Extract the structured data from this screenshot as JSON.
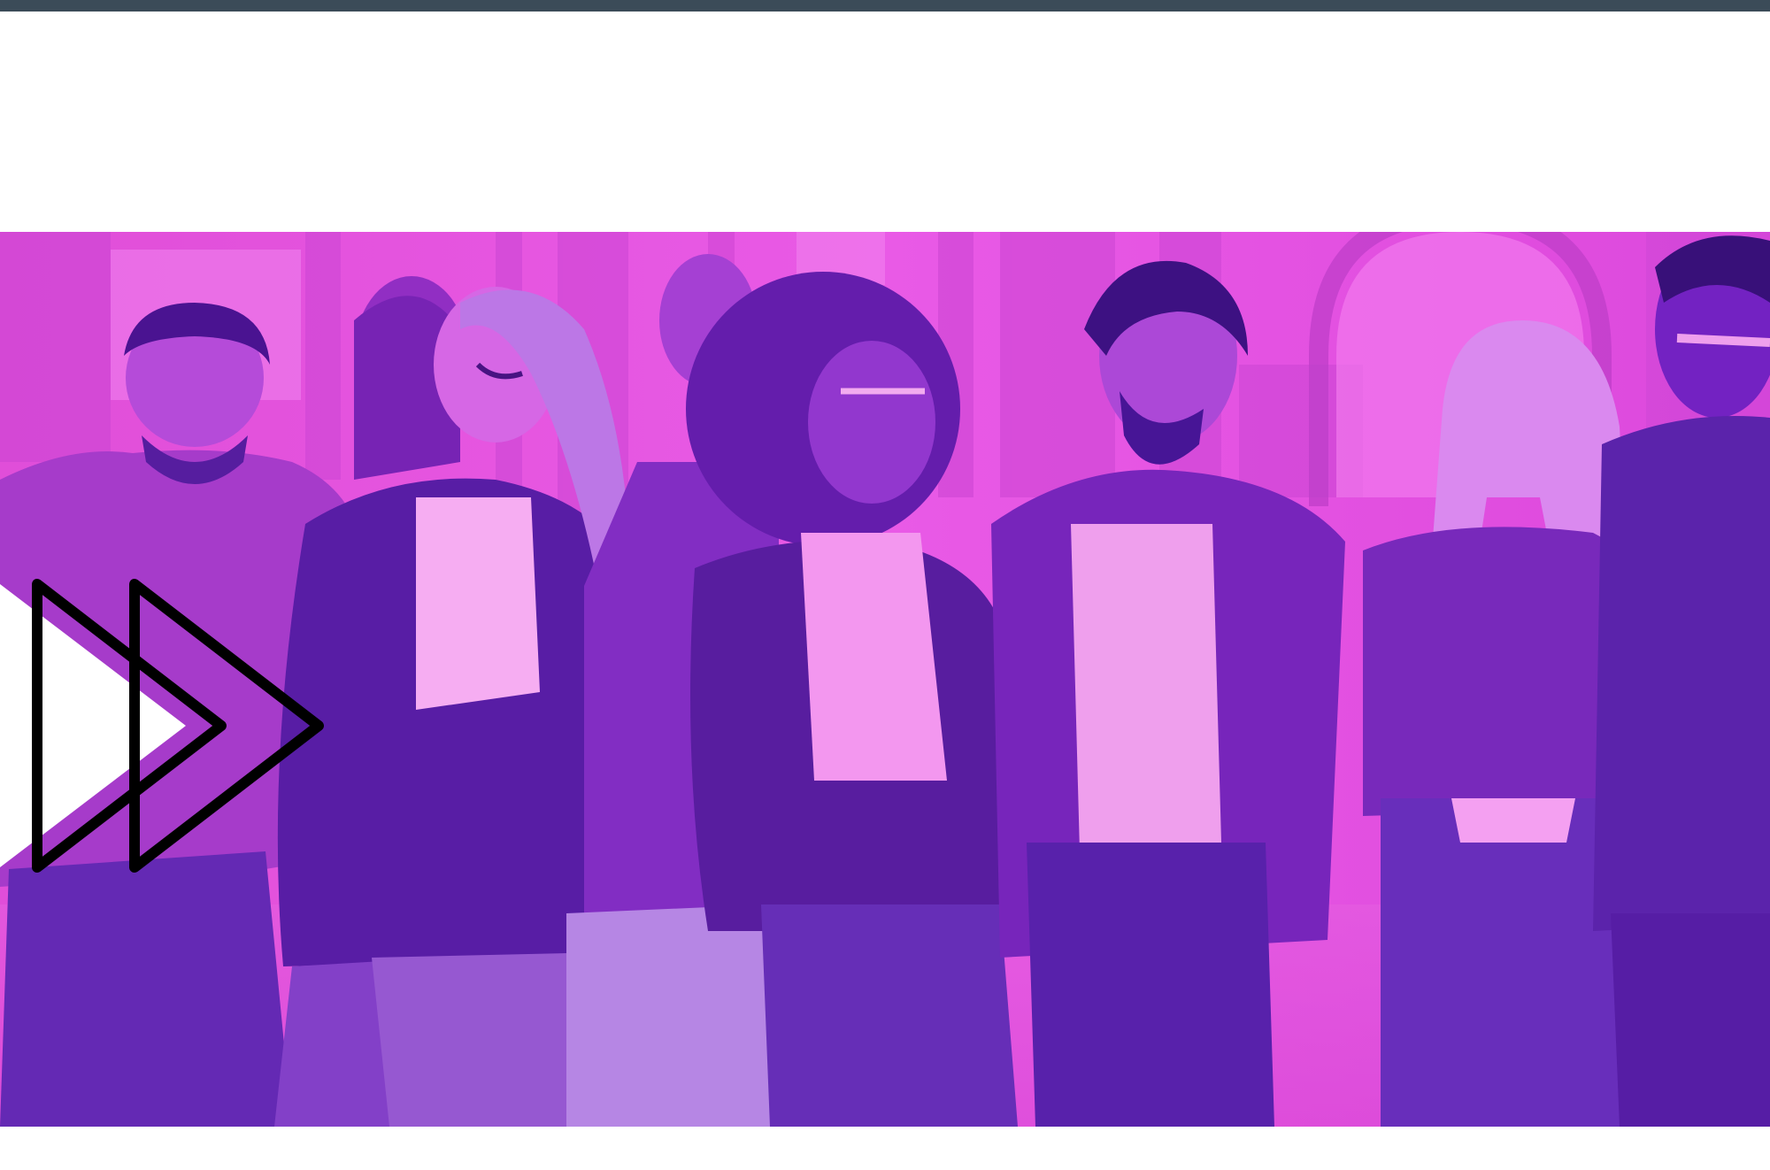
{
  "header_bar": {
    "color": "#3b4b58"
  },
  "banner": {
    "image": "group-of-friends-walking-duotone-photo",
    "tint_light": "#e84ee0",
    "tint_dark": "#6a1fbf"
  },
  "overlay_icon": {
    "icon": "fast-forward-icon",
    "stroke": "#000000",
    "fill": "#ffffff"
  }
}
